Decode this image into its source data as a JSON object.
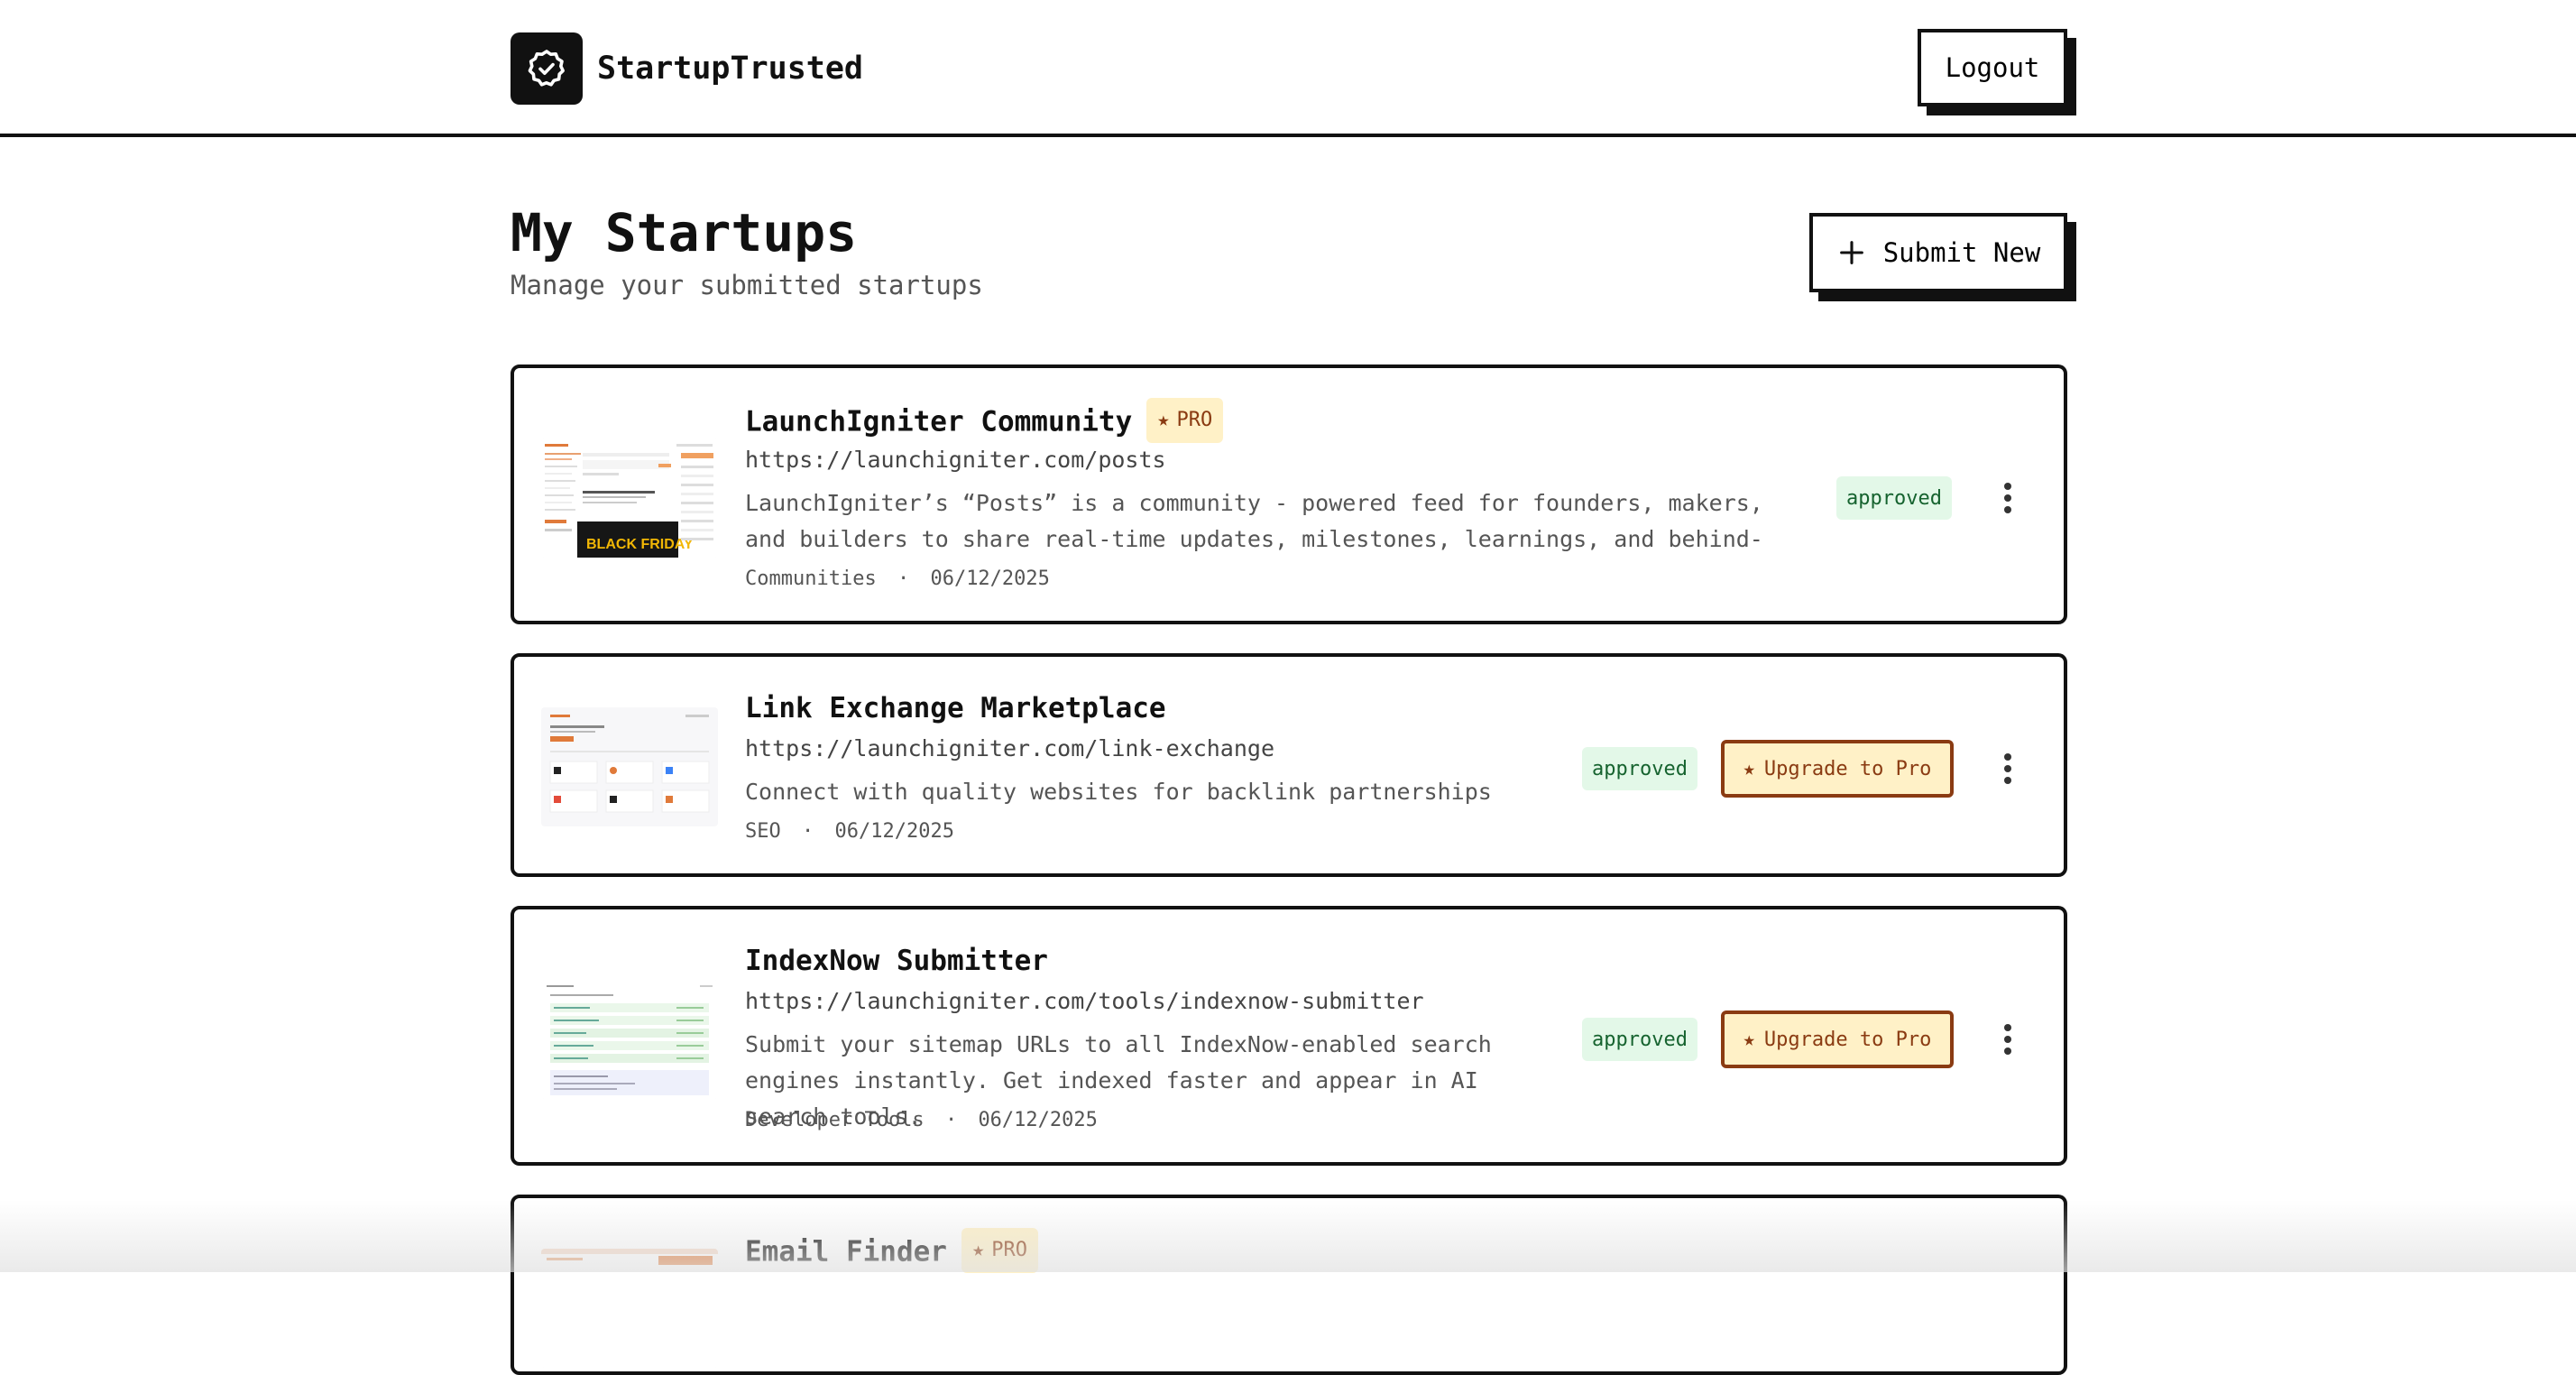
{
  "brand": {
    "name": "StartupTrusted",
    "icon": "verified-badge-icon"
  },
  "header": {
    "logout_label": "Logout"
  },
  "page": {
    "title": "My Startups",
    "subtitle": "Manage your submitted startups",
    "submit_label": "Submit New",
    "submit_icon": "plus-icon"
  },
  "colors": {
    "approved_bg": "#e3f8e8",
    "approved_text": "#16632f",
    "pro_bg": "#fff1c7",
    "pro_text": "#8a3b12"
  },
  "startups": [
    {
      "name": "LaunchIgniter Community",
      "pro_label": "PRO",
      "url": "https://launchigniter.com/posts",
      "description": "LaunchIgniter’s “Posts” is a community - powered feed for founders, makers, and builders to share real-time updates, milestones, learnings, and behind-the-scenes…",
      "category": "Communities",
      "date": "06/12/2025",
      "status": "approved"
    },
    {
      "name": "Link Exchange Marketplace",
      "url": "https://launchigniter.com/link-exchange",
      "description": "Connect with quality websites for backlink partnerships",
      "category": "SEO",
      "date": "06/12/2025",
      "status": "approved",
      "upgrade_label": "Upgrade to Pro"
    },
    {
      "name": "IndexNow Submitter",
      "url": "https://launchigniter.com/tools/indexnow-submitter",
      "description": "Submit your sitemap URLs to all IndexNow-enabled search engines instantly. Get indexed faster and appear in AI search tools.",
      "category": "Developer Tools",
      "date": "06/12/2025",
      "status": "approved",
      "upgrade_label": "Upgrade to Pro"
    },
    {
      "name": "Email Finder",
      "pro_label": "PRO"
    }
  ],
  "separator": "·"
}
